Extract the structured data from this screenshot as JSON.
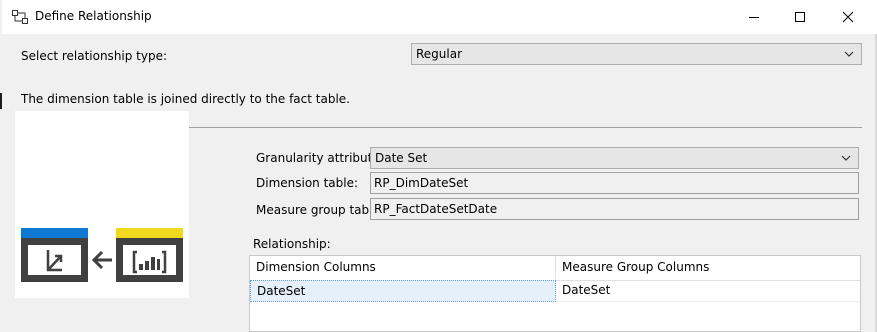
{
  "window": {
    "title": "Define Relationship",
    "icon": "relationship-icon",
    "controls": [
      "minimize-icon",
      "maximize-icon",
      "close-icon"
    ]
  },
  "relationship_type": {
    "label": "Select relationship type:",
    "value": "Regular"
  },
  "description": "The dimension table is joined directly to the fact table.",
  "granularity": {
    "label": "Granularity attribute:",
    "value": "Date Set"
  },
  "dimension_table": {
    "label": "Dimension table:",
    "value": "RP_DimDateSet"
  },
  "measure_group_table": {
    "label": "Measure group table:",
    "value": "RP_FactDateSetDate"
  },
  "relationship": {
    "label": "Relationship:",
    "columns": [
      "Dimension Columns",
      "Measure Group Columns"
    ],
    "rows": [
      [
        "DateSet",
        "DateSet"
      ]
    ]
  },
  "diagram": {
    "dimension_icon": "dimension-axis-icon",
    "measure_icon": "bar-chart-icon",
    "arrow_icon": "arrow-left-icon",
    "dimension_color": "#0f78d2",
    "measure_color": "#f0d81e",
    "frame_color": "#404040"
  }
}
